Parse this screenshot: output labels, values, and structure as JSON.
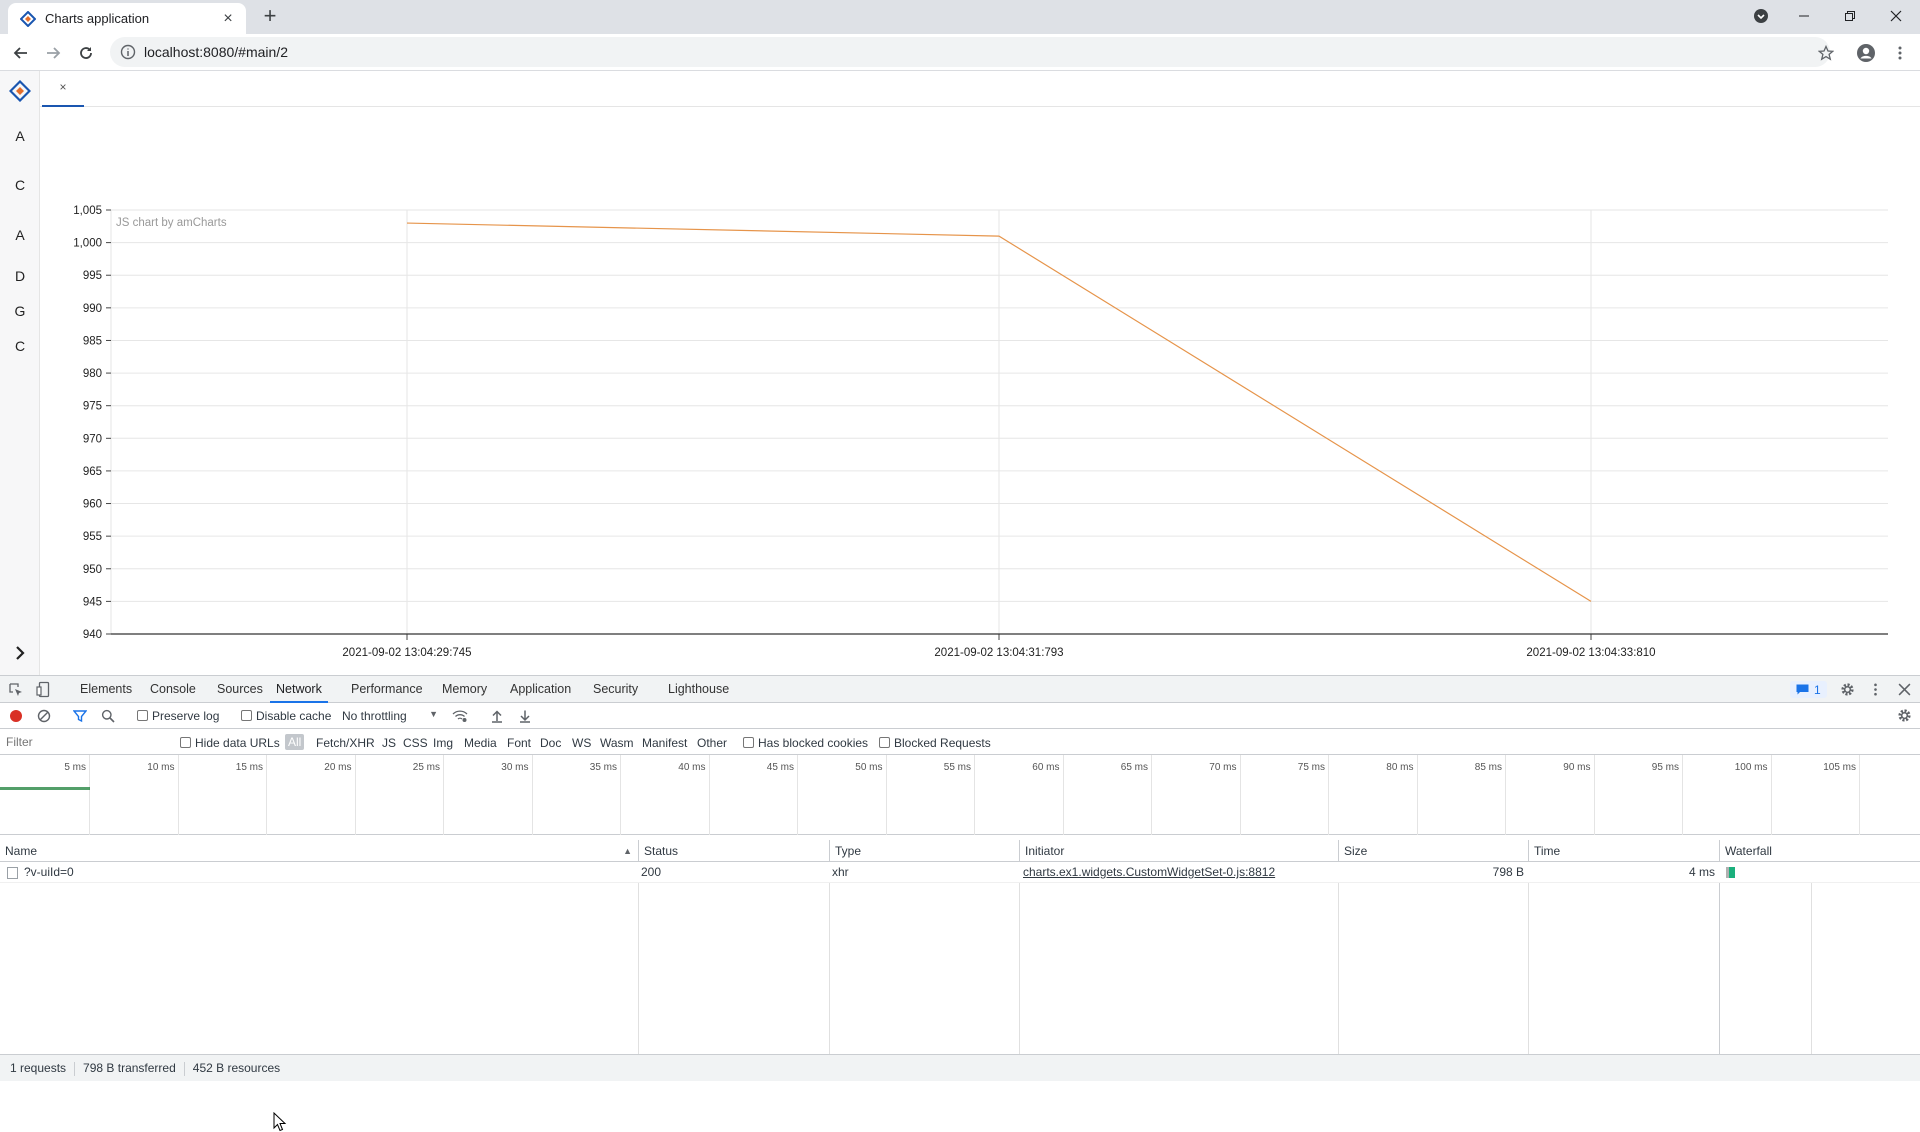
{
  "browser": {
    "tab_title": "Charts application",
    "url": "localhost:8080/#main/2"
  },
  "app": {
    "sidebar_letters": [
      "A",
      "C",
      "A",
      "D",
      "G",
      "C"
    ],
    "tab_close": "×"
  },
  "chart_data": {
    "type": "line",
    "credit": "JS chart by amCharts",
    "x": [
      "2021-09-02 13:04:29:745",
      "2021-09-02 13:04:31:793",
      "2021-09-02 13:04:33:810"
    ],
    "series": [
      {
        "values": [
          1003,
          1001,
          945
        ],
        "color": "#e6944a"
      }
    ],
    "ylim": [
      940,
      1005
    ],
    "yticks": [
      "940",
      "945",
      "950",
      "955",
      "960",
      "965",
      "970",
      "975",
      "980",
      "985",
      "990",
      "995",
      "1,000",
      "1,005"
    ],
    "grid": true
  },
  "devtools": {
    "tabs": [
      "Elements",
      "Console",
      "Sources",
      "Network",
      "Performance",
      "Memory",
      "Application",
      "Security",
      "Lighthouse"
    ],
    "active_tab": "Network",
    "issues_count": "1",
    "toolbar": {
      "preserve_log": "Preserve log",
      "disable_cache": "Disable cache",
      "throttling": "No throttling"
    },
    "filter": {
      "placeholder": "Filter",
      "hide_data_urls": "Hide data URLs",
      "types": [
        "All",
        "Fetch/XHR",
        "JS",
        "CSS",
        "Img",
        "Media",
        "Font",
        "Doc",
        "WS",
        "Wasm",
        "Manifest",
        "Other"
      ],
      "has_blocked_cookies": "Has blocked cookies",
      "blocked_requests": "Blocked Requests"
    },
    "timeline_ticks": [
      "5 ms",
      "10 ms",
      "15 ms",
      "20 ms",
      "25 ms",
      "30 ms",
      "35 ms",
      "40 ms",
      "45 ms",
      "50 ms",
      "55 ms",
      "60 ms",
      "65 ms",
      "70 ms",
      "75 ms",
      "80 ms",
      "85 ms",
      "90 ms",
      "95 ms",
      "100 ms",
      "105 ms"
    ],
    "columns": {
      "name": "Name",
      "status": "Status",
      "type": "Type",
      "initiator": "Initiator",
      "size": "Size",
      "time": "Time",
      "waterfall": "Waterfall"
    },
    "requests": [
      {
        "name": "?v-uiId=0",
        "status": "200",
        "type": "xhr",
        "initiator": "charts.ex1.widgets.CustomWidgetSet-0.js:8812",
        "size": "798 B",
        "time": "4 ms"
      }
    ],
    "summary": {
      "requests": "1 requests",
      "transferred": "798 B transferred",
      "resources": "452 B resources"
    }
  }
}
